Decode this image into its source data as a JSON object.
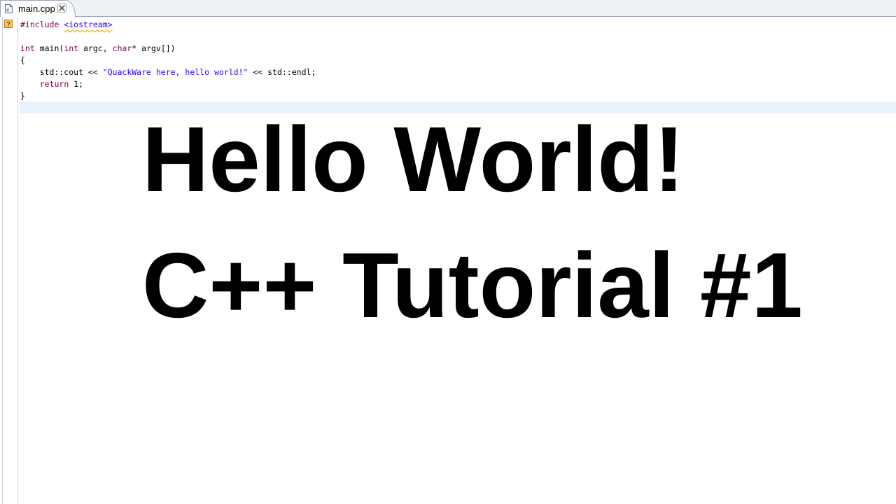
{
  "tab": {
    "filename": "main.cpp",
    "icon": "cpp-file-icon",
    "close_icon": "close-icon"
  },
  "gutter": {
    "marker_icon": "warning-help-icon",
    "marker_color": "#e8a33a"
  },
  "code": {
    "lines": [
      [
        {
          "t": "#include",
          "c": "pp"
        },
        {
          "t": " "
        },
        {
          "t": "<iostream>",
          "c": "inc"
        }
      ],
      [],
      [
        {
          "t": "int",
          "c": "kw"
        },
        {
          "t": " main("
        },
        {
          "t": "int",
          "c": "kw"
        },
        {
          "t": " argc, "
        },
        {
          "t": "char",
          "c": "kw"
        },
        {
          "t": "* argv[])"
        }
      ],
      [
        {
          "t": "{"
        }
      ],
      [
        {
          "t": "    std::cout << "
        },
        {
          "t": "\"QuackWare here, hello world!\"",
          "c": "str"
        },
        {
          "t": " << std::endl;"
        }
      ],
      [
        {
          "t": "    "
        },
        {
          "t": "return",
          "c": "kw"
        },
        {
          "t": " 1;"
        }
      ],
      [
        {
          "t": "}"
        }
      ],
      []
    ]
  },
  "overlay": {
    "line1": "Hello World!",
    "line2": "C++ Tutorial #1"
  },
  "colors": {
    "keyword": "#7f0055",
    "string": "#2a00ff",
    "current_line": "#e8f2fe"
  }
}
